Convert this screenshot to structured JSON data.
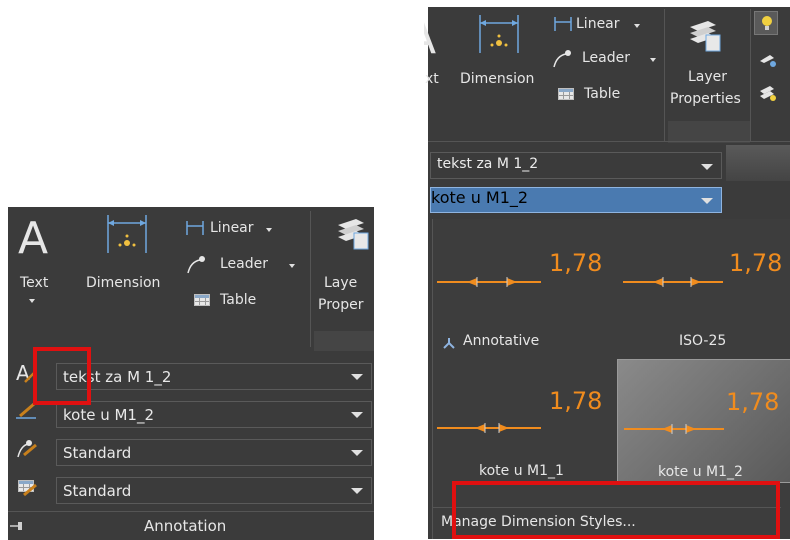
{
  "left_panel": {
    "text_tool": {
      "label": "Text"
    },
    "dimension_tool": {
      "label": "Dimension"
    },
    "linear": {
      "label": "Linear"
    },
    "leader": {
      "label": "Leader"
    },
    "table": {
      "label": "Table"
    },
    "layer_properties": {
      "label_line1": "Laye",
      "label_line2": "Proper"
    },
    "text_style": {
      "value": "tekst za M 1_2"
    },
    "dim_style": {
      "value": "kote u M1_2"
    },
    "multileader_style": {
      "value": "Standard"
    },
    "table_style": {
      "value": "Standard"
    },
    "panel_title": "Annotation"
  },
  "right_panel": {
    "dimension_tool": {
      "label": "Dimension",
      "partial_label": "xt"
    },
    "linear": {
      "label": "Linear"
    },
    "leader": {
      "label": "Leader"
    },
    "table": {
      "label": "Table"
    },
    "layer_properties": {
      "label_line1": "Layer",
      "label_line2": "Properties"
    },
    "text_style_combo": {
      "value": "tekst za M 1_2"
    },
    "dim_style_combo": {
      "value": "kote u M1_2"
    },
    "styles": [
      {
        "name": "Annotative",
        "value": "1,78"
      },
      {
        "name": "ISO-25",
        "value": "1,78"
      },
      {
        "name": "kote u M1_1",
        "value": "1,78"
      },
      {
        "name": "kote u M1_2",
        "value": "1,78"
      }
    ],
    "manage_link": "Manage Dimension Styles..."
  },
  "colors": {
    "panel_bg": "#3b3b3b",
    "accent_orange": "#f08c1e",
    "highlight_red": "#e01010",
    "selection_blue": "#4a7ab0"
  }
}
